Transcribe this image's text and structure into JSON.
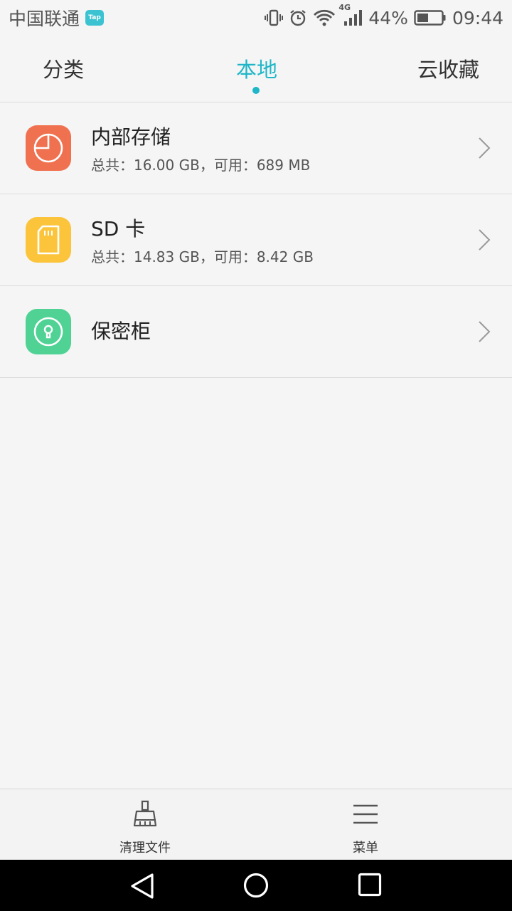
{
  "status_bar": {
    "carrier": "中国联通",
    "tap_badge": "Tap",
    "network": "4G",
    "battery": "44%",
    "time": "09:44"
  },
  "tabs": [
    {
      "label": "分类",
      "active": false
    },
    {
      "label": "本地",
      "active": true
    },
    {
      "label": "云收藏",
      "active": false
    }
  ],
  "storage": [
    {
      "title": "内部存储",
      "subtitle": "总共：16.00 GB，可用：689 MB",
      "icon": "pie-chart-icon",
      "color": "#f07150"
    },
    {
      "title": "SD 卡",
      "subtitle": "总共：14.83 GB，可用：8.42 GB",
      "icon": "sd-card-icon",
      "color": "#fbc43a"
    },
    {
      "title": "保密柜",
      "subtitle": "",
      "icon": "safe-lock-icon",
      "color": "#4fd294"
    }
  ],
  "bottom_bar": {
    "clean_label": "清理文件",
    "menu_label": "菜单"
  },
  "colors": {
    "accent": "#1fb6c8",
    "background": "#f5f5f5"
  }
}
